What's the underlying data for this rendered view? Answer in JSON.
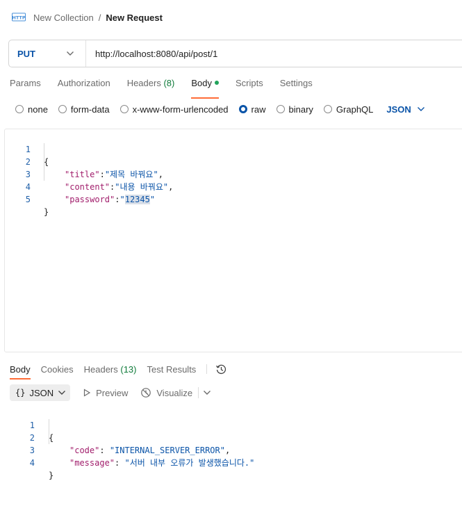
{
  "header": {
    "collection": "New Collection",
    "separator": "/",
    "request_name": "New Request"
  },
  "request": {
    "method": "PUT",
    "url": "http://localhost:8080/api/post/1"
  },
  "request_tabs": {
    "params": "Params",
    "authorization": "Authorization",
    "headers": "Headers",
    "headers_count": "(8)",
    "body": "Body",
    "scripts": "Scripts",
    "settings": "Settings"
  },
  "body_types": {
    "none": "none",
    "form_data": "form-data",
    "urlencoded": "x-www-form-urlencoded",
    "raw": "raw",
    "binary": "binary",
    "graphql": "GraphQL",
    "selected": "raw",
    "language": "JSON"
  },
  "request_body": {
    "line_numbers": [
      "1",
      "2",
      "3",
      "4",
      "5"
    ],
    "open_brace": "{",
    "close_brace": "}",
    "fields": [
      {
        "key": "\"title\"",
        "value": "\"제목 바꿔요\""
      },
      {
        "key": "\"content\"",
        "value": "\"내용 바꿔요\""
      },
      {
        "key": "\"password\"",
        "value": "12345"
      }
    ]
  },
  "response_tabs": {
    "body": "Body",
    "cookies": "Cookies",
    "headers": "Headers",
    "headers_count": "(13)",
    "test_results": "Test Results"
  },
  "response_toolbar": {
    "format_braces": "{}",
    "format": "JSON",
    "preview": "Preview",
    "visualize": "Visualize"
  },
  "response_body": {
    "line_numbers": [
      "1",
      "2",
      "3",
      "4"
    ],
    "open_brace": "{",
    "close_brace": "}",
    "fields": [
      {
        "key": "\"code\"",
        "value": "\"INTERNAL_SERVER_ERROR\""
      },
      {
        "key": "\"message\"",
        "value": "\"서버 내부 오류가 발생했습니다.\""
      }
    ]
  },
  "colors": {
    "accent_orange": "#ff6c37",
    "method_blue": "#0b54a8",
    "status_green": "#22a35b",
    "json_key": "#a11d6b",
    "json_string": "#0b54a8"
  }
}
